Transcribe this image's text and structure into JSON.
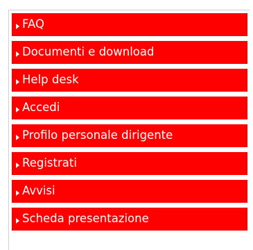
{
  "menu": {
    "items": [
      {
        "label": "FAQ"
      },
      {
        "label": "Documenti e download"
      },
      {
        "label": "Help desk"
      },
      {
        "label": "Accedi"
      },
      {
        "label": "Profilo personale dirigente"
      },
      {
        "label": "Registrati"
      },
      {
        "label": "Avvisi"
      },
      {
        "label": "Scheda presentazione"
      }
    ],
    "icon": "triangle-right-icon",
    "colors": {
      "item_background": "#ff0000",
      "item_text": "#ffffff"
    }
  }
}
